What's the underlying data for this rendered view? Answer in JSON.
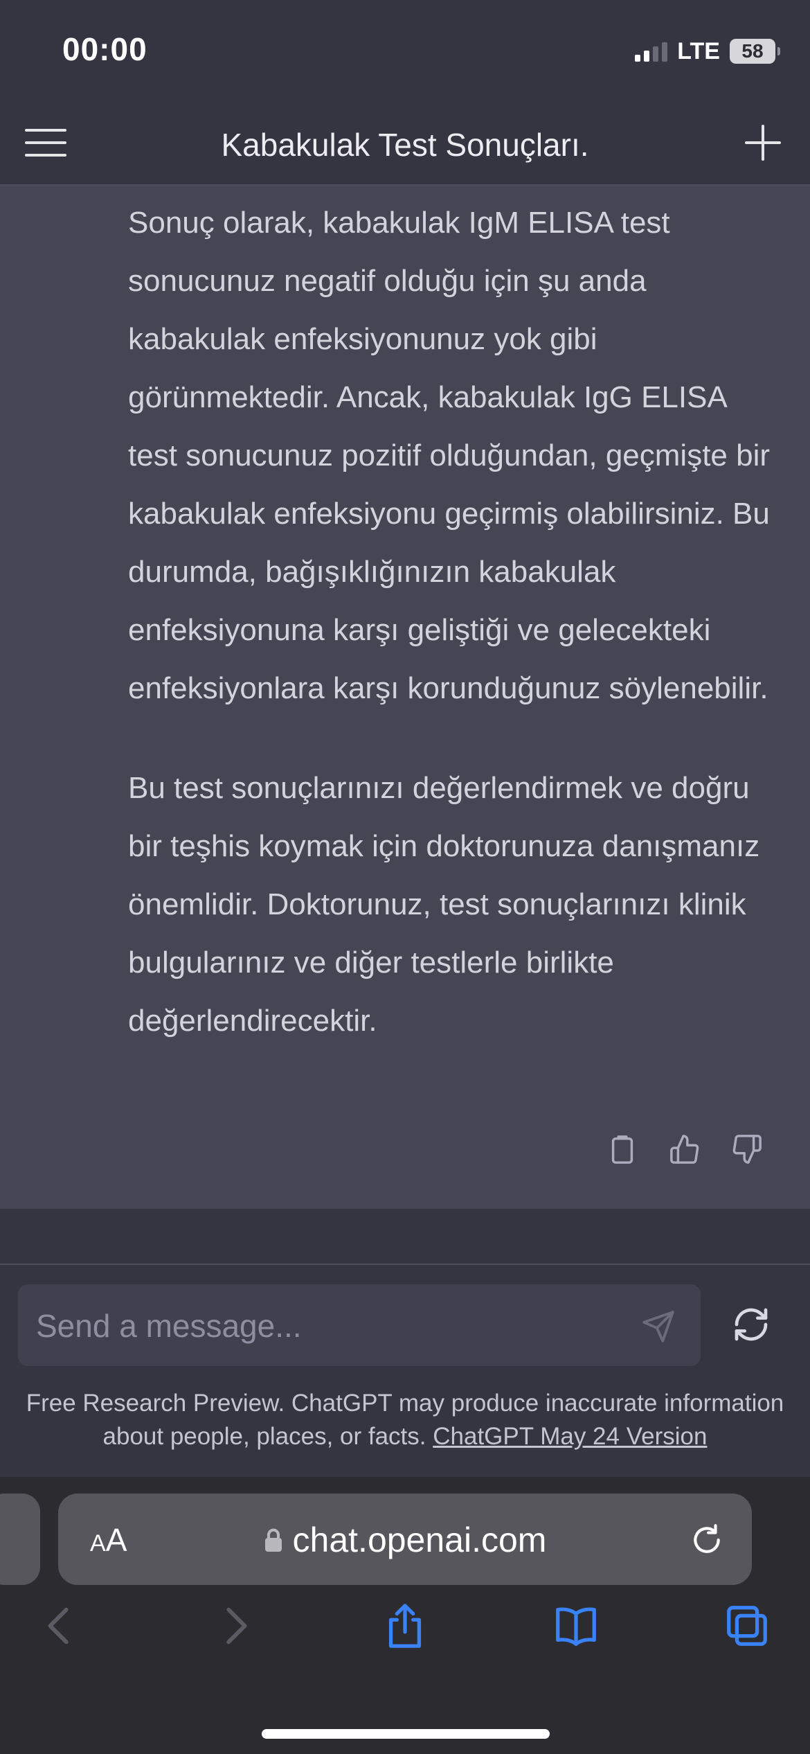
{
  "status_bar": {
    "time": "00:00",
    "network": "LTE",
    "battery": "58"
  },
  "header": {
    "title": "Kabakulak Test Sonuçları."
  },
  "message": {
    "paragraphs": [
      "Sonuç olarak, kabakulak IgM ELISA test sonucunuz negatif olduğu için şu anda kabakulak enfeksiyonunuz yok gibi görünmektedir. Ancak, kabakulak IgG ELISA test sonucunuz pozitif olduğundan, geçmişte bir kabakulak enfeksiyonu geçirmiş olabilirsiniz. Bu durumda, bağışıklığınızın kabakulak enfeksiyonuna karşı geliştiği ve gelecekteki enfeksiyonlara karşı korunduğunuz söylenebilir.",
      "Bu test sonuçlarınızı değerlendirmek ve doğru bir teşhis koymak için doktorunuza danışmanız önemlidir. Doktorunuz, test sonuçlarınızı klinik bulgularınız ve diğer testlerle birlikte değerlendirecektir."
    ]
  },
  "composer": {
    "placeholder": "Send a message..."
  },
  "disclaimer": {
    "text": "Free Research Preview. ChatGPT may produce inaccurate information about people, places, or facts.",
    "link": "ChatGPT May 24 Version"
  },
  "browser": {
    "aa_small": "A",
    "aa_big": "A",
    "url": "chat.openai.com"
  },
  "colors": {
    "background": "#343541",
    "message_bg": "#444654",
    "input_bg": "#40414f",
    "safari_accent": "#3a82f7"
  }
}
